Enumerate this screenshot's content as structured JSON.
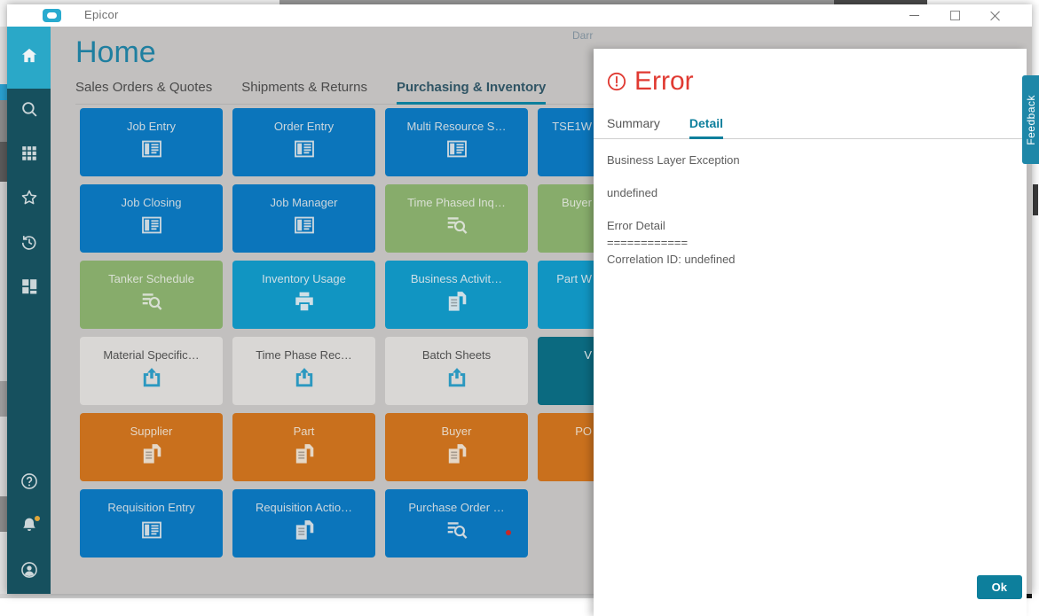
{
  "titlebar": {
    "app_name": "Epicor"
  },
  "window_controls": [
    {
      "name": "minimize"
    },
    {
      "name": "maximize"
    },
    {
      "name": "close"
    }
  ],
  "desktop": {
    "peek_text": "Darr"
  },
  "page": {
    "title": "Home"
  },
  "tabs": [
    {
      "label": "Sales Orders & Quotes",
      "active": false
    },
    {
      "label": "Shipments & Returns",
      "active": false
    },
    {
      "label": "Purchasing & Inventory",
      "active": true
    }
  ],
  "tiles": [
    {
      "label": "Job Entry",
      "color": "blue",
      "icon": "form"
    },
    {
      "label": "Order Entry",
      "color": "blue",
      "icon": "form"
    },
    {
      "label": "Multi Resource S…",
      "color": "blue",
      "icon": "form"
    },
    {
      "label": "TSE1W",
      "color": "blue",
      "icon": "form",
      "cut": true
    },
    {
      "label": "Job Closing",
      "color": "blue",
      "icon": "form"
    },
    {
      "label": "Job Manager",
      "color": "blue",
      "icon": "form"
    },
    {
      "label": "Time Phased Inq…",
      "color": "green",
      "icon": "search-list"
    },
    {
      "label": "Buyer",
      "color": "green",
      "icon": "search-list",
      "cut": true
    },
    {
      "label": "Tanker Schedule",
      "color": "green",
      "icon": "search-list"
    },
    {
      "label": "Inventory Usage",
      "color": "cyan",
      "icon": "printer"
    },
    {
      "label": "Business Activit…",
      "color": "cyan",
      "icon": "report"
    },
    {
      "label": "Part W",
      "color": "cyan",
      "icon": "report",
      "cut": true
    },
    {
      "label": "Material Specific…",
      "color": "light",
      "icon": "upload"
    },
    {
      "label": "Time Phase Rec…",
      "color": "light",
      "icon": "upload"
    },
    {
      "label": "Batch Sheets",
      "color": "light",
      "icon": "upload"
    },
    {
      "label": "V",
      "color": "teal",
      "icon": "none",
      "cut": true
    },
    {
      "label": "Supplier",
      "color": "orange",
      "icon": "report"
    },
    {
      "label": "Part",
      "color": "orange",
      "icon": "report"
    },
    {
      "label": "Buyer",
      "color": "orange",
      "icon": "report"
    },
    {
      "label": "PO",
      "color": "orange",
      "icon": "report",
      "cut": true
    },
    {
      "label": "Requisition Entry",
      "color": "blue",
      "icon": "form"
    },
    {
      "label": "Requisition Actio…",
      "color": "blue",
      "icon": "report"
    },
    {
      "label": "Purchase Order …",
      "color": "blue",
      "icon": "search-list",
      "notification_dot": true
    }
  ],
  "sidebar": {
    "items": [
      {
        "icon": "home",
        "label": "home",
        "active": true
      },
      {
        "icon": "search",
        "label": "search"
      },
      {
        "icon": "apps",
        "label": "apps"
      },
      {
        "icon": "star",
        "label": "favorites"
      },
      {
        "icon": "history",
        "label": "recent"
      },
      {
        "icon": "dashboard",
        "label": "dashboards"
      }
    ],
    "bottom_items": [
      {
        "icon": "help",
        "label": "help"
      },
      {
        "icon": "bell",
        "label": "notifications",
        "badge": true
      },
      {
        "icon": "person",
        "label": "account"
      }
    ]
  },
  "error_panel": {
    "title": "Error",
    "tabs": [
      {
        "label": "Summary",
        "active": false
      },
      {
        "label": "Detail",
        "active": true
      }
    ],
    "lines": [
      "Business Layer Exception",
      "undefined",
      "Error Detail",
      "============",
      "Correlation ID: undefined"
    ],
    "ok_label": "Ok"
  },
  "feedback_tab": {
    "label": "Feedback"
  },
  "colors": {
    "accent": "#0d7f9c",
    "error": "#e03a32",
    "tile_blue": "#0b75bb",
    "tile_green": "#87ac6b",
    "tile_cyan": "#1195c2",
    "tile_teal": "#0b6a80",
    "tile_orange": "#c9701d",
    "tile_light": "#d9d7d5",
    "sidebar_bg": "#16505e",
    "sidebar_active": "#2aa8c8"
  }
}
